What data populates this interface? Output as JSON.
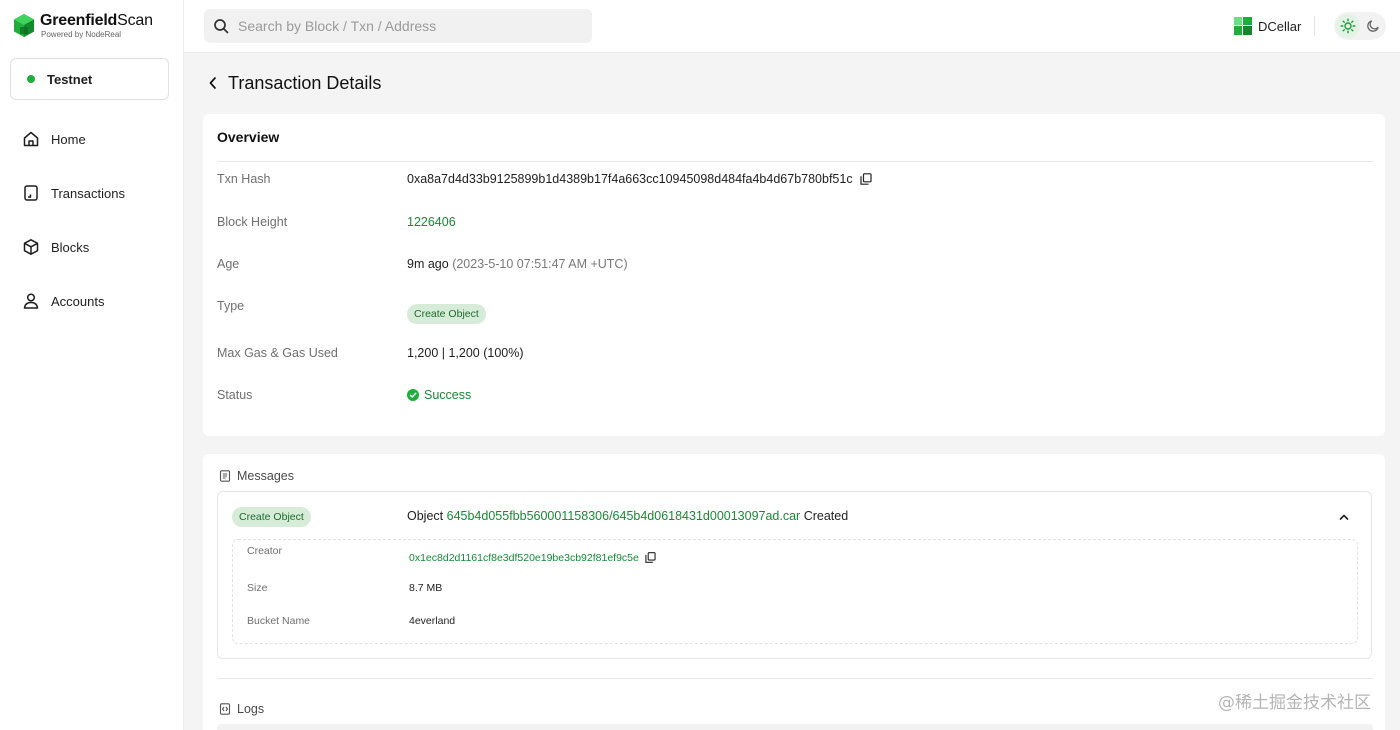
{
  "brand": {
    "name_bold": "Greenfield",
    "name_light": "Scan",
    "powered_by": "Powered by NodeReal"
  },
  "network": {
    "label": "Testnet",
    "status_color": "#1fae3b"
  },
  "sidebar": {
    "items": [
      {
        "label": "Home",
        "icon": "home-icon"
      },
      {
        "label": "Transactions",
        "icon": "transactions-icon"
      },
      {
        "label": "Blocks",
        "icon": "cube-icon"
      },
      {
        "label": "Accounts",
        "icon": "user-icon"
      }
    ]
  },
  "search": {
    "placeholder": "Search by Block / Txn / Address",
    "value": ""
  },
  "header": {
    "dcellar_label": "DCellar",
    "theme": "light"
  },
  "page": {
    "title": "Transaction Details"
  },
  "overview": {
    "title": "Overview",
    "txn_hash": {
      "label": "Txn Hash",
      "value": "0xa8a7d4d33b9125899b1d4389b17f4a663cc10945098d484fa4b4d67b780bf51c"
    },
    "block_height": {
      "label": "Block Height",
      "value": "1226406"
    },
    "age": {
      "label": "Age",
      "relative": "9m ago",
      "absolute": "(2023-5-10 07:51:47 AM +UTC)"
    },
    "type": {
      "label": "Type",
      "value": "Create Object"
    },
    "gas": {
      "label": "Max Gas & Gas Used",
      "value": "1,200 | 1,200 (100%)"
    },
    "status": {
      "label": "Status",
      "value": "Success"
    }
  },
  "messages": {
    "title": "Messages",
    "items": [
      {
        "badge": "Create Object",
        "prefix": "Object",
        "object_path": "645b4d055fbb560001158306/645b4d0618431d00013097ad.car",
        "suffix": "Created",
        "creator": {
          "label": "Creator",
          "value": "0x1ec8d2d1161cf8e3df520e19be3cb92f81ef9c5e"
        },
        "size": {
          "label": "Size",
          "value": "8.7 MB"
        },
        "bucket": {
          "label": "Bucket Name",
          "value": "4everland"
        }
      }
    ]
  },
  "logs": {
    "title": "Logs"
  },
  "watermark": "@稀土掘金技术社区",
  "colors": {
    "accent": "#178a35",
    "badge_bg": "#d6ecd9",
    "page_bg": "#f4f4f4"
  }
}
